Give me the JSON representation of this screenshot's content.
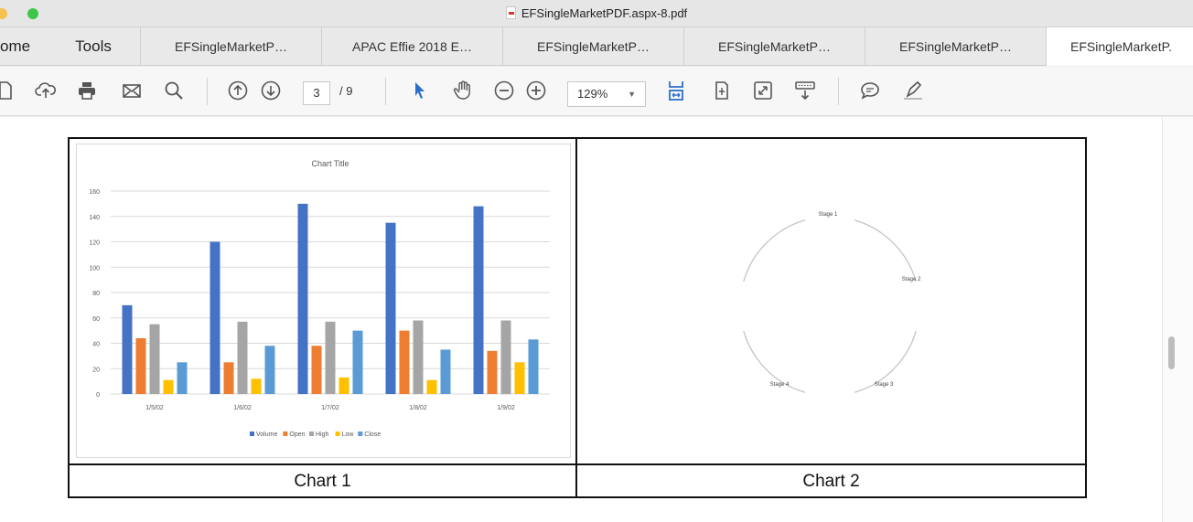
{
  "window": {
    "title": "EFSingleMarketPDF.aspx-8.pdf"
  },
  "tabs": [
    {
      "label": "ome"
    },
    {
      "label": "Tools"
    },
    {
      "label": "EFSingleMarketP…"
    },
    {
      "label": "APAC Effie 2018 E…"
    },
    {
      "label": "EFSingleMarketP…"
    },
    {
      "label": "EFSingleMarketP…"
    },
    {
      "label": "EFSingleMarketP…"
    },
    {
      "label": "EFSingleMarketP."
    }
  ],
  "toolbar": {
    "page_current": "3",
    "page_total": "/ 9",
    "zoom": "129%",
    "icons": [
      "open-file-icon",
      "upload-icon",
      "print-icon",
      "email-icon",
      "search-icon",
      "previous-page-icon",
      "next-page-icon",
      "select-tool-icon",
      "hand-tool-icon",
      "zoom-out-icon",
      "zoom-in-icon",
      "fit-width-icon",
      "page-layout-icon",
      "fullscreen-icon",
      "read-mode-icon",
      "comment-icon",
      "highlight-icon"
    ],
    "accent": "#2c6ecb"
  },
  "document": {
    "caption_1": "Chart 1",
    "caption_2": "Chart 2"
  },
  "chart_data": [
    {
      "type": "bar",
      "title": "Chart Title",
      "categories": [
        "1/5/02",
        "1/6/02",
        "1/7/02",
        "1/8/02",
        "1/9/02"
      ],
      "series": [
        {
          "name": "Volume",
          "color": "#4472c4",
          "values": [
            70,
            120,
            150,
            135,
            148
          ]
        },
        {
          "name": "Open",
          "color": "#ed7d31",
          "values": [
            44,
            25,
            38,
            50,
            34
          ]
        },
        {
          "name": "High",
          "color": "#a5a5a5",
          "values": [
            55,
            57,
            57,
            58,
            58
          ]
        },
        {
          "name": "Low",
          "color": "#ffc000",
          "values": [
            11,
            12,
            13,
            11,
            25
          ]
        },
        {
          "name": "Close",
          "color": "#5b9bd5",
          "values": [
            25,
            38,
            50,
            35,
            43
          ]
        }
      ],
      "yticks": [
        "0",
        "20",
        "40",
        "60",
        "80",
        "100",
        "120",
        "140",
        "160"
      ],
      "ylim": [
        0,
        160
      ],
      "grid": true,
      "legend": "bottom"
    },
    {
      "type": "cycle",
      "stages": [
        "Stage 1",
        "Stage 2",
        "Stage 3",
        "Stage 4"
      ]
    }
  ]
}
